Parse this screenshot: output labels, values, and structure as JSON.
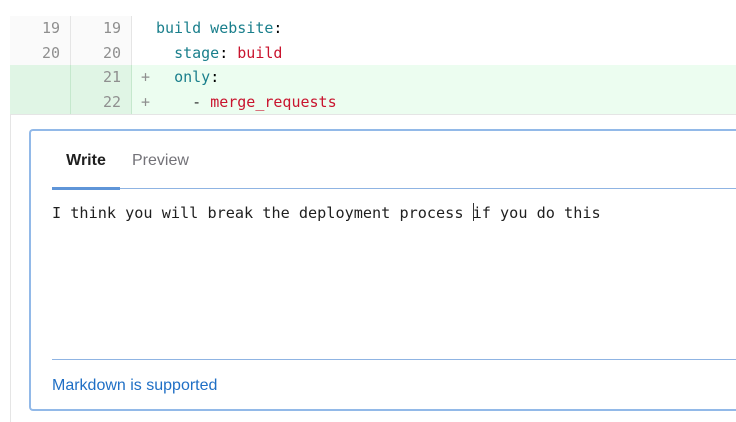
{
  "diff": {
    "lines": [
      {
        "old": "19",
        "new": "19",
        "marker": "",
        "indent": "",
        "key": "build website",
        "sep": ":",
        "dash": "",
        "value": ""
      },
      {
        "old": "20",
        "new": "20",
        "marker": "",
        "indent": "  ",
        "key": "stage",
        "sep": ": ",
        "dash": "",
        "value": "build"
      },
      {
        "old": "",
        "new": "21",
        "marker": "+",
        "indent": "  ",
        "key": "only",
        "sep": ":",
        "dash": "",
        "value": ""
      },
      {
        "old": "",
        "new": "22",
        "marker": "+",
        "indent": "    ",
        "key": "",
        "sep": "",
        "dash": "- ",
        "value": "merge_requests"
      }
    ]
  },
  "comment": {
    "tabs": {
      "write": "Write",
      "preview": "Preview"
    },
    "text_before_caret": "I think you will break the deployment process ",
    "text_after_caret": "if you do this",
    "markdown_link": "Markdown is supported"
  },
  "colors": {
    "added_bg": "#ecfdf0",
    "key": "#1a7f8c",
    "value": "#c9142e",
    "focus_border": "#92b9e8",
    "link": "#1f6fc5"
  }
}
